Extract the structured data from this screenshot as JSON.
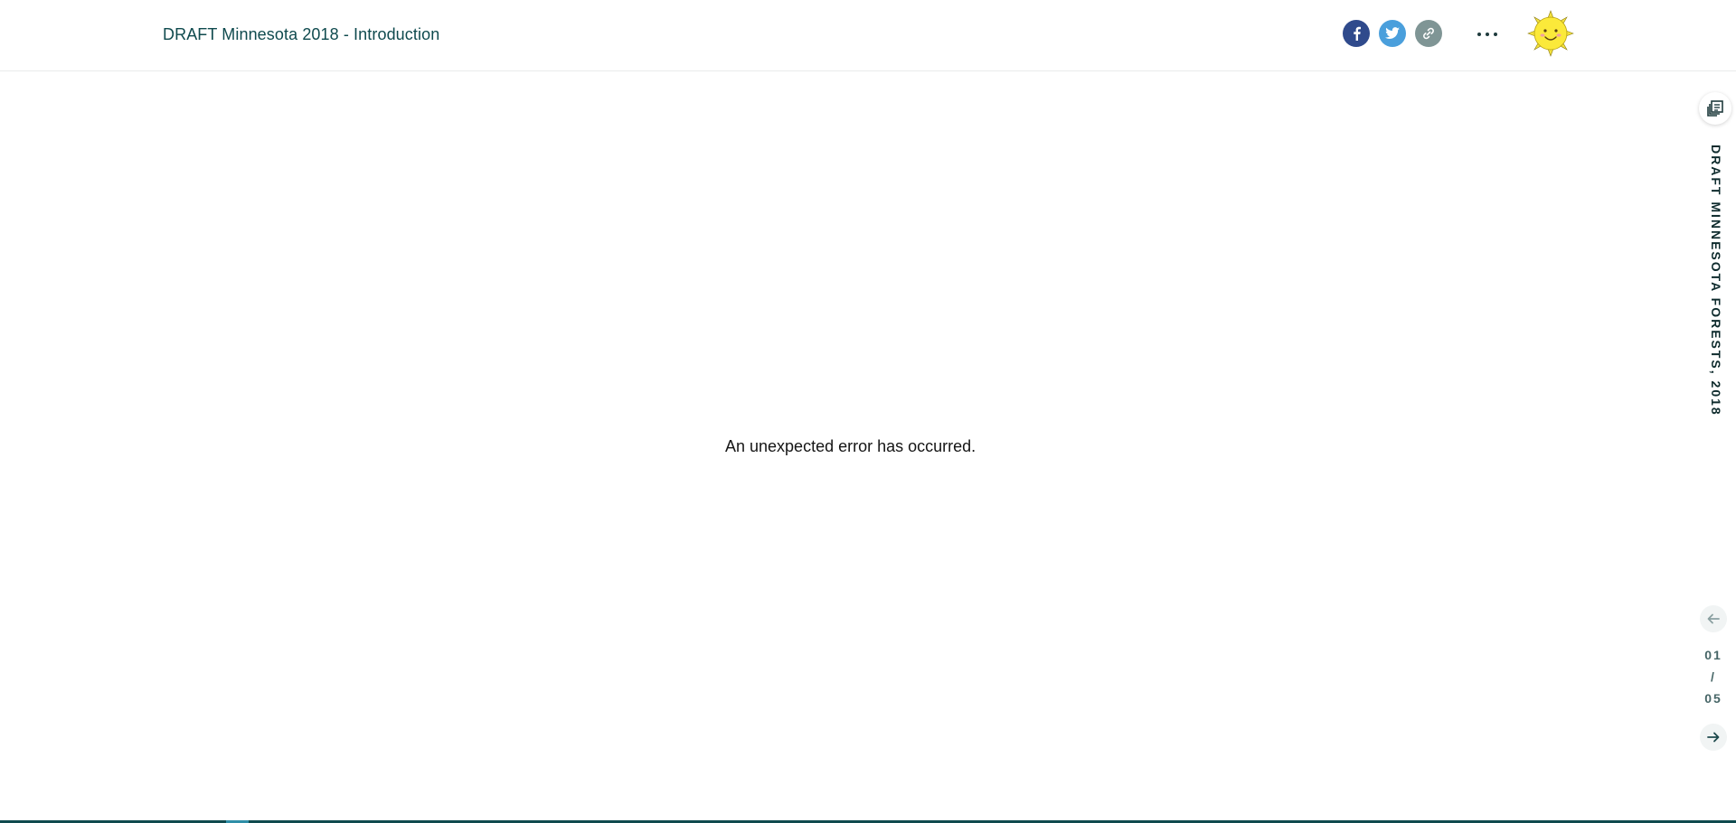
{
  "header": {
    "title": "DRAFT Minnesota 2018 - Introduction",
    "share": [
      {
        "name": "facebook-icon",
        "color": "#2f4a8c"
      },
      {
        "name": "twitter-icon",
        "color": "#4a9fdc"
      },
      {
        "name": "link-icon",
        "color": "#7f9595"
      }
    ],
    "more_icon": "more-options-icon",
    "logo": "sun-logo"
  },
  "main": {
    "error_message": "An unexpected error has occurred."
  },
  "sidebar": {
    "story_icon": "story-collection-icon",
    "vertical_title": "DRAFT MINNESOTA FORESTS, 2018",
    "prev_icon": "arrow-left-icon",
    "next_icon": "arrow-right-icon",
    "counter": {
      "current": "01",
      "separator": "/",
      "total": "05"
    }
  },
  "progress": {
    "fraction": 0.2,
    "track_color": "#0f4a4e",
    "fill_color": "#2f8fa8"
  },
  "colors": {
    "title": "#0f4a4e",
    "counter": "#476667"
  }
}
